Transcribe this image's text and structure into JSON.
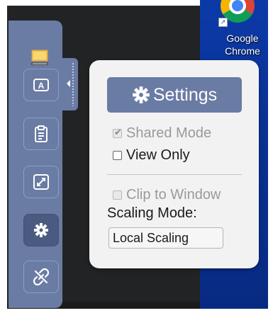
{
  "desktop": {
    "shortcut_label": "Google Chrome",
    "colors": {
      "desktop_blue": "#0a3294",
      "desktop_dark": "#222325"
    }
  },
  "sidebar": {
    "accent": "#6a7ba4",
    "items": [
      {
        "icon": "keyboard-icon",
        "glyph": "A",
        "active": false
      },
      {
        "icon": "clipboard-icon",
        "active": false
      },
      {
        "icon": "fullscreen-icon",
        "active": false
      },
      {
        "icon": "gear-icon",
        "active": true
      },
      {
        "icon": "disconnect-icon",
        "active": false
      }
    ]
  },
  "settings": {
    "title": "Settings",
    "shared_mode": {
      "label": "Shared Mode",
      "checked": true,
      "enabled": false
    },
    "view_only": {
      "label": "View Only",
      "checked": false,
      "enabled": true
    },
    "clip_to_window": {
      "label": "Clip to Window",
      "checked": false,
      "enabled": false
    },
    "scaling_mode_label": "Scaling Mode:",
    "scaling_mode_value": "Local Scaling"
  }
}
